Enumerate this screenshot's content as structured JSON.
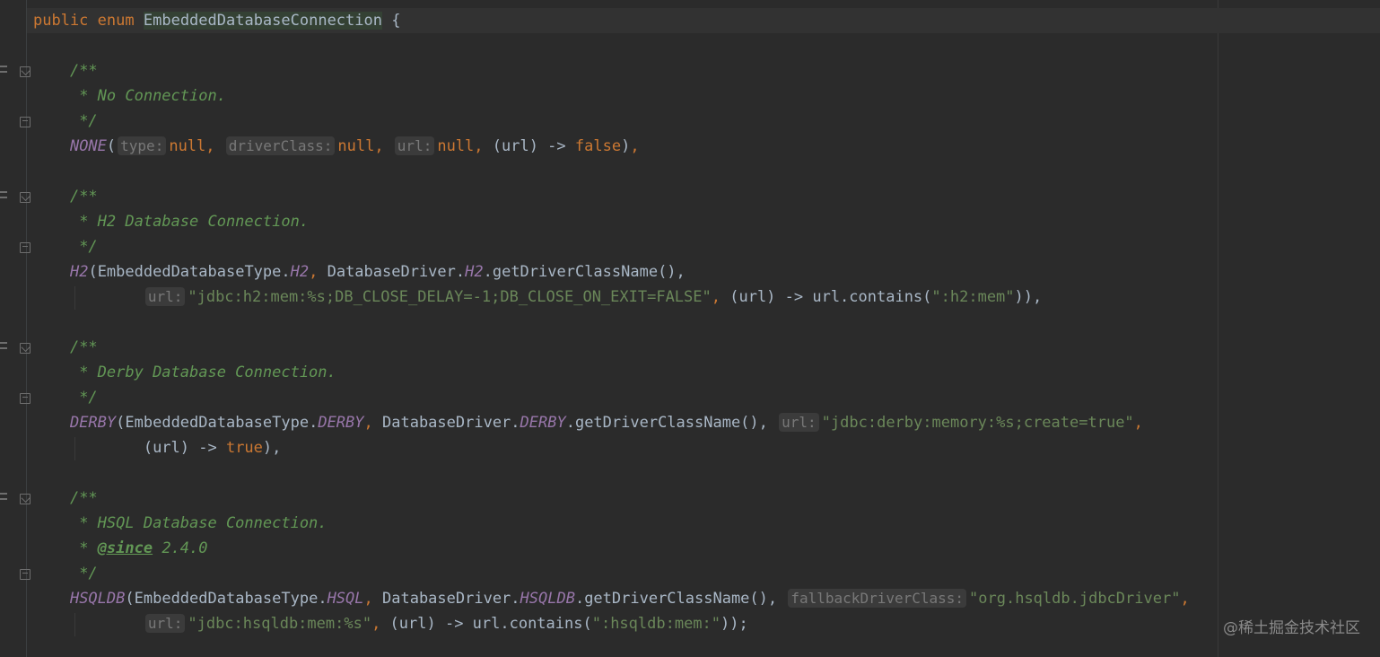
{
  "header": {
    "kw_public": "public",
    "kw_enum": "enum",
    "class_name": "EmbeddedDatabaseConnection",
    "brace": "{"
  },
  "none": {
    "doc_open": "/**",
    "doc_line": " * No Connection.",
    "doc_close": " */",
    "name": "NONE",
    "hint_type": "type:",
    "hint_driver": "driverClass:",
    "hint_url": "url:",
    "null1": "null",
    "null2": "null",
    "null3": "null",
    "lambda": "(url) -> ",
    "false_kw": "false"
  },
  "h2": {
    "doc_open": "/**",
    "doc_line": " * H2 Database Connection.",
    "doc_close": " */",
    "name": "H2",
    "type_cls": "EmbeddedDatabaseType.",
    "type_const": "H2",
    "driver_cls": "DatabaseDriver.",
    "driver_const": "H2",
    "method": ".getDriverClassName(),",
    "hint_url": "url:",
    "url_str": "\"jdbc:h2:mem:%s;DB_CLOSE_DELAY=-1;DB_CLOSE_ON_EXIT=FALSE\"",
    "lambda": "(url) -> url.contains(",
    "contains_str": "\":h2:mem\"",
    "tail": ")),"
  },
  "derby": {
    "doc_open": "/**",
    "doc_line": " * Derby Database Connection.",
    "doc_close": " */",
    "name": "DERBY",
    "type_cls": "EmbeddedDatabaseType.",
    "type_const": "DERBY",
    "driver_cls": "DatabaseDriver.",
    "driver_const": "DERBY",
    "method": ".getDriverClassName(),",
    "hint_url": "url:",
    "url_str": "\"jdbc:derby:memory:%s;create=true\"",
    "lambda": "(url) -> ",
    "true_kw": "true",
    "tail": "),"
  },
  "hsqldb": {
    "doc_open": "/**",
    "doc_line": " * HSQL Database Connection.",
    "doc_since_prefix": " * ",
    "doc_since_tag": "@since",
    "doc_since_ver": " 2.4.0",
    "doc_close": " */",
    "name": "HSQLDB",
    "type_cls": "EmbeddedDatabaseType.",
    "type_const": "HSQL",
    "driver_cls": "DatabaseDriver.",
    "driver_const": "HSQLDB",
    "method": ".getDriverClassName(),",
    "hint_fallback": "fallbackDriverClass:",
    "fallback_str": "\"org.hsqldb.jdbcDriver\"",
    "hint_url": "url:",
    "url_str": "\"jdbc:hsqldb:mem:%s\"",
    "lambda": "(url) -> url.contains(",
    "contains_str": "\":hsqldb:mem:\"",
    "tail": "));"
  },
  "watermark": "@稀土掘金技术社区"
}
